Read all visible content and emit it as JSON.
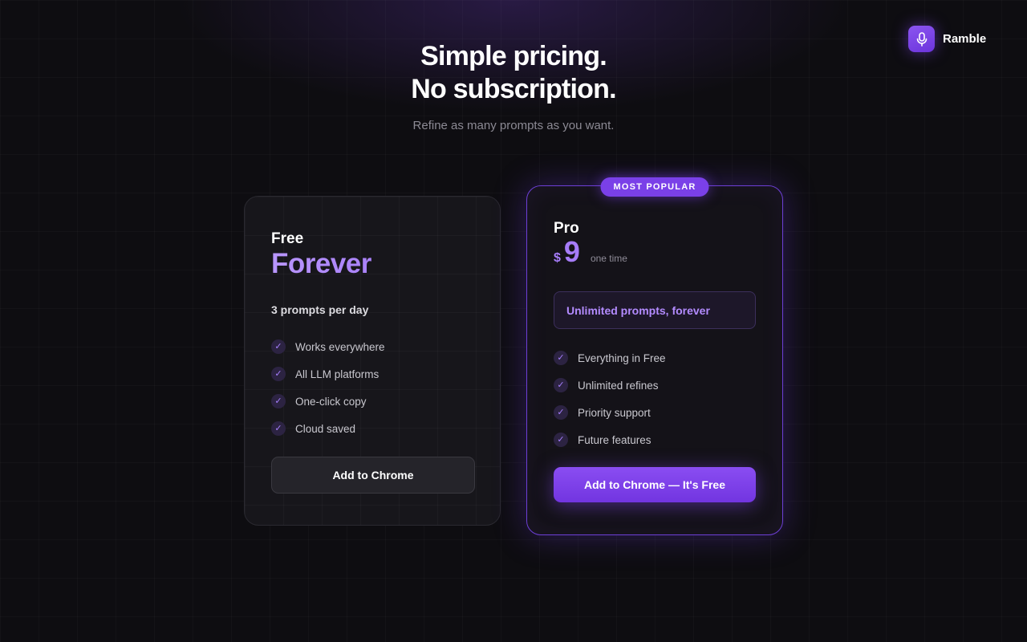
{
  "brand": {
    "name": "Ramble",
    "icon": "microphone-icon",
    "accent": "#7a40e8"
  },
  "hero": {
    "title_line1": "Simple pricing.",
    "title_line2": "No subscription.",
    "subtitle": "Refine as many prompts as you want."
  },
  "free_plan": {
    "name": "Free",
    "headline": "Forever",
    "limit": "3 prompts per day",
    "features": [
      "Works everywhere",
      "All LLM platforms",
      "One-click copy",
      "Cloud saved"
    ],
    "cta": "Add to Chrome"
  },
  "pro_plan": {
    "badge": "MOST POPULAR",
    "name": "Pro",
    "currency": "$",
    "price": "9",
    "price_note": "one time",
    "highlight": "Unlimited prompts, forever",
    "features": [
      "Everything in Free",
      "Unlimited refines",
      "Priority support",
      "Future features"
    ],
    "cta": "Add to Chrome — It's Free"
  }
}
